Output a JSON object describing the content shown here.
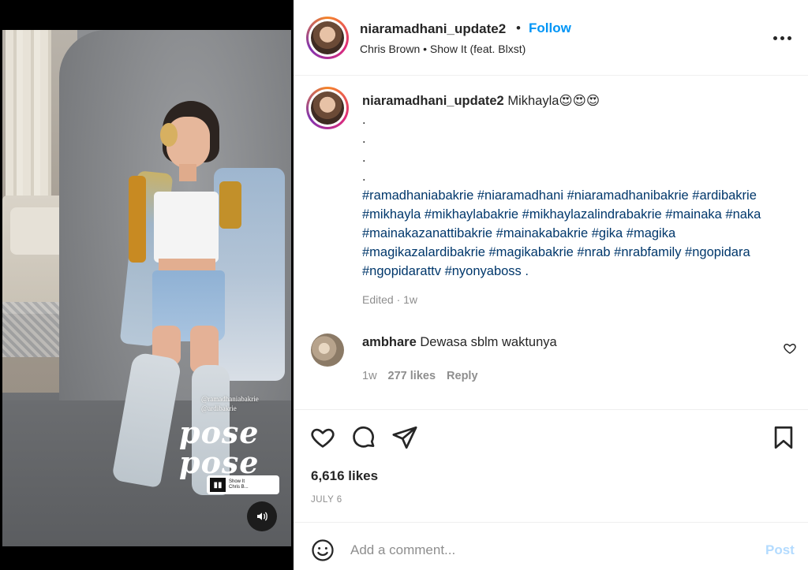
{
  "media": {
    "tag_lines": [
      "@ramadhaniabakrie",
      "@ardibakrie"
    ],
    "pose_text": [
      "pose",
      "pose"
    ],
    "music_sticker": [
      "Show It",
      "Chris B..."
    ]
  },
  "header": {
    "username": "niaramadhani_update2",
    "separator": "•",
    "follow_label": "Follow",
    "song": "Chris Brown • Show It (feat. Blxst)"
  },
  "caption": {
    "username": "niaramadhani_update2",
    "text": "Mikhayla😍😍😍",
    "dots": [
      ".",
      ".",
      ".",
      "."
    ],
    "hashtags": "#ramadhaniabakrie #niaramadhani #niaramadhanibakrie #ardibakrie #mikhayla #mikhaylabakrie #mikhaylazalindrabakrie #mainaka #naka #mainakazanattibakrie #mainakabakrie #gika #magika #magikazalardibakrie #magikabakrie #nrab #nrabfamily #ngopidara #ngopidarattv #nyonyaboss .",
    "meta": "Edited · 1w"
  },
  "comment": {
    "username": "ambhare",
    "text": "Dewasa sblm waktunya",
    "time": "1w",
    "likes": "277 likes",
    "reply_label": "Reply"
  },
  "actions": {
    "likes": "6,616 likes",
    "date": "JULY 6"
  },
  "add_comment": {
    "placeholder": "Add a comment...",
    "post_label": "Post"
  },
  "colors": {
    "link_blue": "#0095f6",
    "hashtag_blue": "#00376b",
    "muted": "#8e8e8e",
    "post_disabled": "#b3dbff"
  }
}
